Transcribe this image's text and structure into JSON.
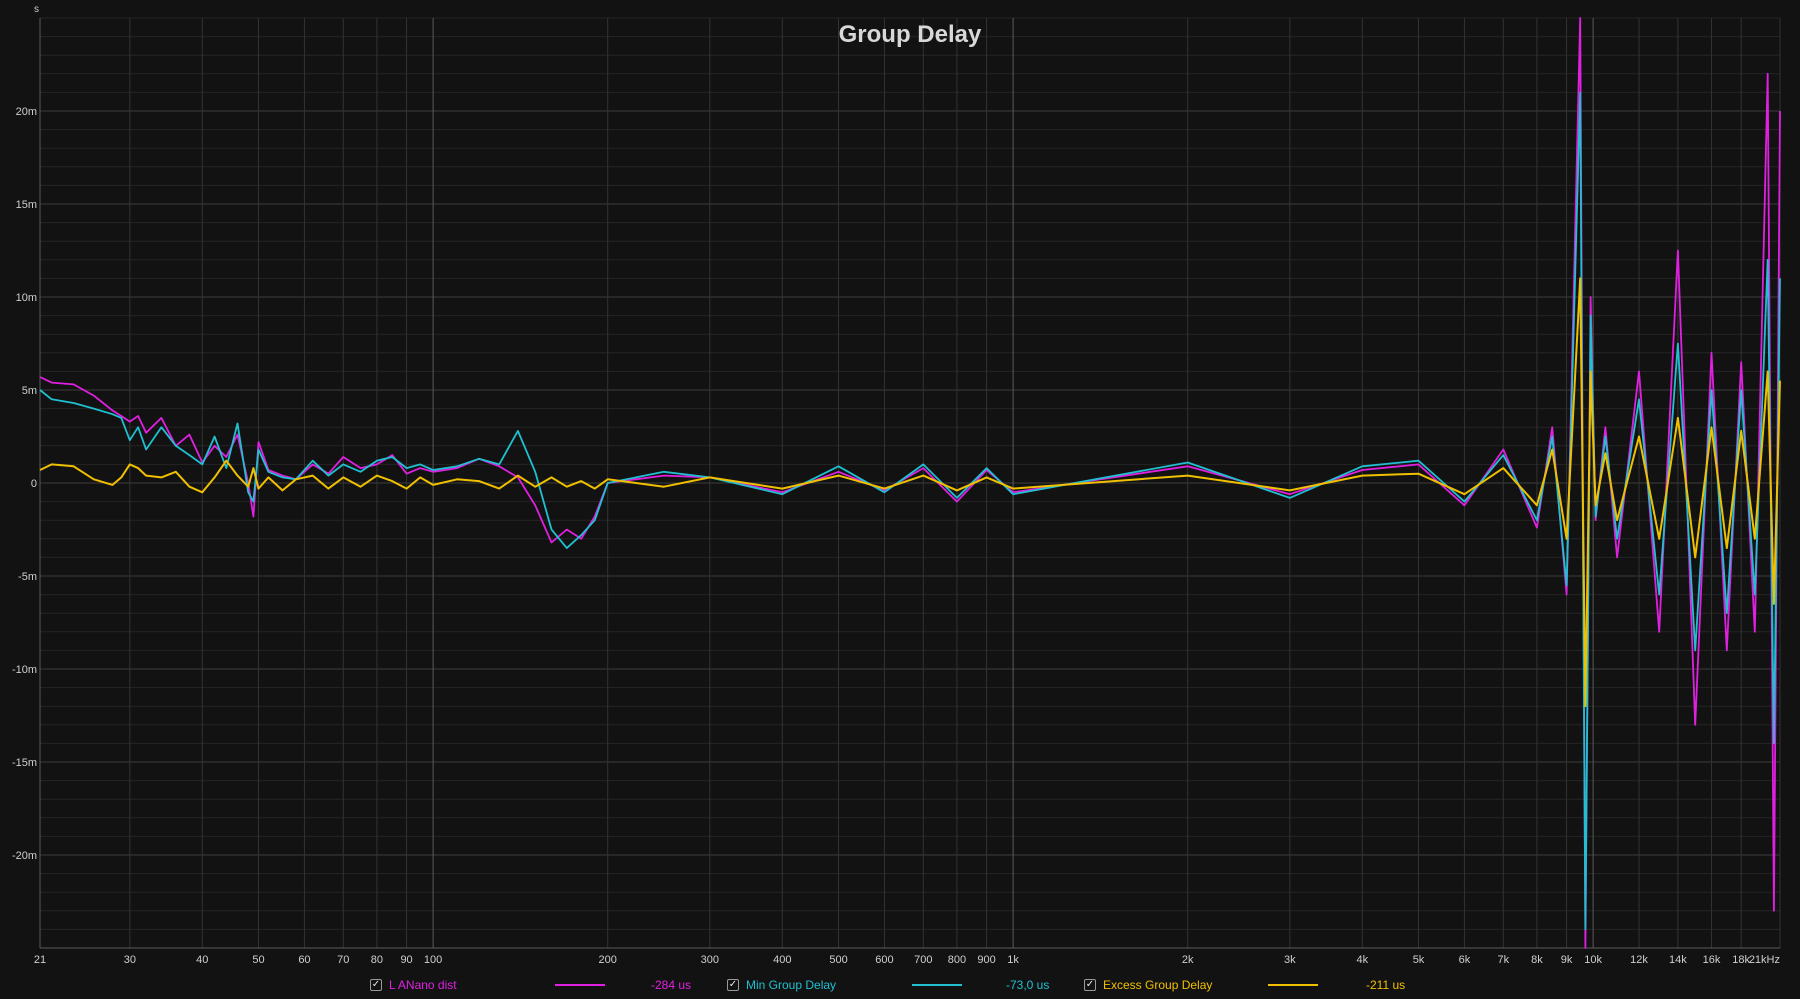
{
  "chart_data": {
    "type": "line",
    "title": "Group Delay",
    "ylabel": "s",
    "xlabel": "",
    "x_scale": "log",
    "xlim": [
      21,
      21000
    ],
    "ylim": [
      -0.025,
      0.025
    ],
    "grid": true,
    "x_ticks": [
      {
        "v": 21,
        "l": "21"
      },
      {
        "v": 30,
        "l": "30"
      },
      {
        "v": 40,
        "l": "40"
      },
      {
        "v": 50,
        "l": "50"
      },
      {
        "v": 60,
        "l": "60"
      },
      {
        "v": 70,
        "l": "70"
      },
      {
        "v": 80,
        "l": "80"
      },
      {
        "v": 90,
        "l": "90"
      },
      {
        "v": 100,
        "l": "100"
      },
      {
        "v": 200,
        "l": "200"
      },
      {
        "v": 300,
        "l": "300"
      },
      {
        "v": 400,
        "l": "400"
      },
      {
        "v": 500,
        "l": "500"
      },
      {
        "v": 600,
        "l": "600"
      },
      {
        "v": 700,
        "l": "700"
      },
      {
        "v": 800,
        "l": "800"
      },
      {
        "v": 900,
        "l": "900"
      },
      {
        "v": 1000,
        "l": "1k"
      },
      {
        "v": 2000,
        "l": "2k"
      },
      {
        "v": 3000,
        "l": "3k"
      },
      {
        "v": 4000,
        "l": "4k"
      },
      {
        "v": 5000,
        "l": "5k"
      },
      {
        "v": 6000,
        "l": "6k"
      },
      {
        "v": 7000,
        "l": "7k"
      },
      {
        "v": 8000,
        "l": "8k"
      },
      {
        "v": 9000,
        "l": "9k"
      },
      {
        "v": 10000,
        "l": "10k"
      },
      {
        "v": 12000,
        "l": "12k"
      },
      {
        "v": 14000,
        "l": "14k"
      },
      {
        "v": 16000,
        "l": "16k"
      },
      {
        "v": 18000,
        "l": "18k"
      },
      {
        "v": 21000,
        "l": "21kHz"
      }
    ],
    "y_ticks": [
      {
        "v": 0.02,
        "l": "20m"
      },
      {
        "v": 0.015,
        "l": "15m"
      },
      {
        "v": 0.01,
        "l": "10m"
      },
      {
        "v": 0.005,
        "l": "5m"
      },
      {
        "v": 0,
        "l": "0"
      },
      {
        "v": -0.005,
        "l": "-5m"
      },
      {
        "v": -0.01,
        "l": "-10m"
      },
      {
        "v": -0.015,
        "l": "-15m"
      },
      {
        "v": -0.02,
        "l": "-20m"
      }
    ],
    "series": [
      {
        "name": "L ANano dist",
        "color": "#e020e0",
        "legend_value": "-284 us",
        "x": [
          21,
          22,
          24,
          26,
          28,
          29,
          30,
          31,
          32,
          34,
          36,
          38,
          40,
          42,
          44,
          46,
          48,
          49,
          50,
          52,
          55,
          58,
          62,
          66,
          70,
          75,
          80,
          85,
          90,
          95,
          100,
          110,
          120,
          130,
          140,
          150,
          160,
          170,
          180,
          190,
          200,
          250,
          300,
          400,
          500,
          600,
          700,
          800,
          900,
          1000,
          2000,
          3000,
          4000,
          5000,
          6000,
          7000,
          8000,
          8500,
          9000,
          9500,
          9700,
          9900,
          10100,
          10500,
          11000,
          12000,
          13000,
          14000,
          15000,
          16000,
          17000,
          18000,
          19000,
          20000,
          20500,
          21000
        ],
        "y": [
          0.0057,
          0.0054,
          0.0053,
          0.0047,
          0.0039,
          0.0036,
          0.0033,
          0.0036,
          0.0027,
          0.0035,
          0.002,
          0.0026,
          0.0011,
          0.002,
          0.0014,
          0.0026,
          0.0,
          -0.0018,
          0.0022,
          0.0007,
          0.0004,
          0.0002,
          0.001,
          0.0005,
          0.0014,
          0.0008,
          0.001,
          0.0015,
          0.0005,
          0.0008,
          0.0006,
          0.0008,
          0.0013,
          0.0009,
          0.0003,
          -0.0012,
          -0.0032,
          -0.0025,
          -0.003,
          -0.0018,
          0.0,
          0.0004,
          0.0003,
          -0.0005,
          0.0006,
          -0.0004,
          0.0008,
          -0.001,
          0.0007,
          -0.0005,
          0.0009,
          -0.0006,
          0.0007,
          0.001,
          -0.0012,
          0.0018,
          -0.0024,
          0.003,
          -0.006,
          0.025,
          -0.025,
          0.01,
          -0.002,
          0.003,
          -0.004,
          0.006,
          -0.008,
          0.0125,
          -0.013,
          0.007,
          -0.009,
          0.0065,
          -0.008,
          0.022,
          -0.023,
          0.02
        ]
      },
      {
        "name": "Min Group Delay",
        "color": "#20c0d0",
        "legend_value": "-73,0 us",
        "x": [
          21,
          22,
          24,
          26,
          28,
          29,
          30,
          31,
          32,
          34,
          36,
          38,
          40,
          42,
          44,
          46,
          48,
          49,
          50,
          52,
          55,
          58,
          62,
          66,
          70,
          75,
          80,
          85,
          90,
          95,
          100,
          110,
          120,
          130,
          140,
          150,
          160,
          170,
          180,
          190,
          200,
          250,
          300,
          400,
          500,
          600,
          700,
          800,
          900,
          1000,
          2000,
          3000,
          4000,
          5000,
          6000,
          7000,
          8000,
          8500,
          9000,
          9500,
          9700,
          9900,
          10100,
          10500,
          11000,
          12000,
          13000,
          14000,
          15000,
          16000,
          17000,
          18000,
          19000,
          20000,
          20500,
          21000
        ],
        "y": [
          0.005,
          0.0045,
          0.0043,
          0.004,
          0.0037,
          0.0035,
          0.0023,
          0.003,
          0.0018,
          0.003,
          0.002,
          0.0015,
          0.001,
          0.0025,
          0.0008,
          0.0032,
          -0.0005,
          -0.001,
          0.0018,
          0.0006,
          0.0003,
          0.0002,
          0.0012,
          0.0004,
          0.001,
          0.0006,
          0.0012,
          0.0014,
          0.0008,
          0.001,
          0.0007,
          0.0009,
          0.0013,
          0.001,
          0.0028,
          0.0006,
          -0.0025,
          -0.0035,
          -0.0028,
          -0.002,
          0.0,
          0.0006,
          0.0003,
          -0.0006,
          0.0009,
          -0.0005,
          0.001,
          -0.0008,
          0.0008,
          -0.0006,
          0.0011,
          -0.0008,
          0.0009,
          0.0012,
          -0.001,
          0.0015,
          -0.002,
          0.0025,
          -0.0055,
          0.021,
          -0.024,
          0.009,
          -0.0018,
          0.0025,
          -0.003,
          0.0045,
          -0.006,
          0.0075,
          -0.009,
          0.005,
          -0.007,
          0.005,
          -0.006,
          0.012,
          -0.014,
          0.011
        ]
      },
      {
        "name": "Excess Group Delay",
        "color": "#f0c000",
        "legend_value": "-211 us",
        "x": [
          21,
          22,
          24,
          26,
          28,
          29,
          30,
          31,
          32,
          34,
          36,
          38,
          40,
          42,
          44,
          46,
          48,
          49,
          50,
          52,
          55,
          58,
          62,
          66,
          70,
          75,
          80,
          85,
          90,
          95,
          100,
          110,
          120,
          130,
          140,
          150,
          160,
          170,
          180,
          190,
          200,
          250,
          300,
          400,
          500,
          600,
          700,
          800,
          900,
          1000,
          2000,
          3000,
          4000,
          5000,
          6000,
          7000,
          8000,
          8500,
          9000,
          9500,
          9700,
          9900,
          10100,
          10500,
          11000,
          12000,
          13000,
          14000,
          15000,
          16000,
          17000,
          18000,
          19000,
          20000,
          20500,
          21000
        ],
        "y": [
          0.0007,
          0.001,
          0.0009,
          0.0002,
          -0.0001,
          0.0003,
          0.001,
          0.0008,
          0.0004,
          0.0003,
          0.0006,
          -0.0002,
          -0.0005,
          0.0003,
          0.0012,
          0.0004,
          -0.0002,
          0.0008,
          -0.0003,
          0.0003,
          -0.0004,
          0.0002,
          0.0004,
          -0.0003,
          0.0003,
          -0.0002,
          0.0004,
          0.0001,
          -0.0003,
          0.0003,
          -0.0001,
          0.0002,
          0.0001,
          -0.0003,
          0.0004,
          -0.0002,
          0.0003,
          -0.0002,
          0.0001,
          -0.0003,
          0.0002,
          -0.0002,
          0.0003,
          -0.0003,
          0.0004,
          -0.0003,
          0.0004,
          -0.0004,
          0.0003,
          -0.0003,
          0.0004,
          -0.0004,
          0.0004,
          0.0005,
          -0.0006,
          0.0008,
          -0.0012,
          0.0018,
          -0.003,
          0.011,
          -0.012,
          0.006,
          -0.0012,
          0.0016,
          -0.002,
          0.0025,
          -0.003,
          0.0035,
          -0.004,
          0.003,
          -0.0035,
          0.0028,
          -0.003,
          0.006,
          -0.0065,
          0.0055
        ]
      }
    ]
  }
}
